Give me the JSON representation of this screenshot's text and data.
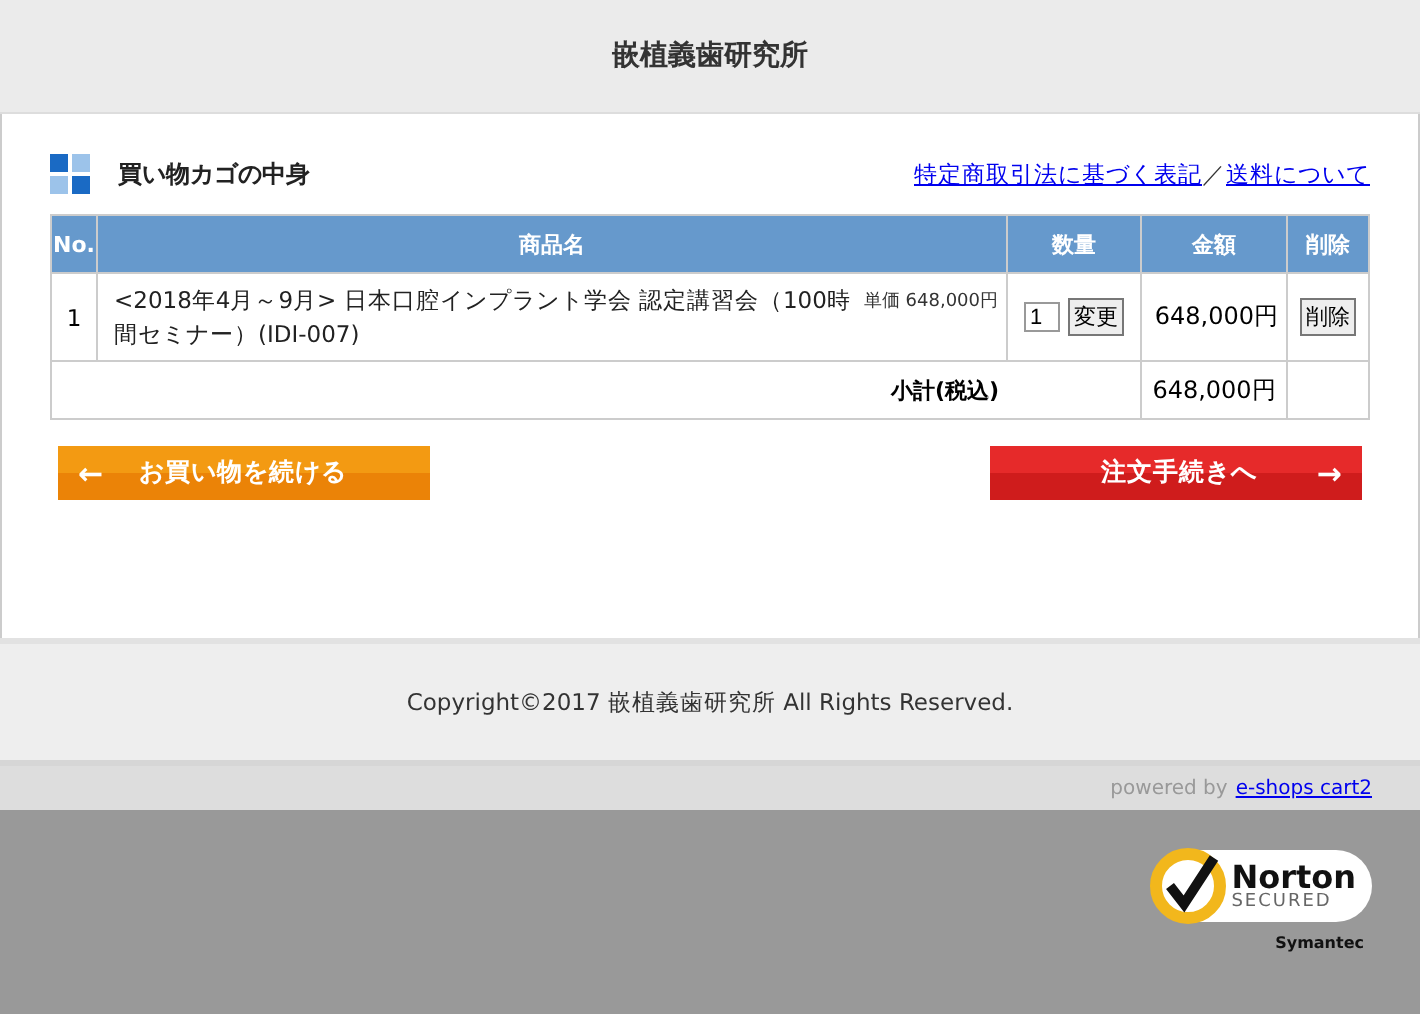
{
  "header": {
    "title": "嵌植義歯研究所"
  },
  "cart": {
    "heading": "買い物カゴの中身",
    "links": [
      "特定商取引法に基づく表記",
      "送料について"
    ],
    "separator": "／",
    "columns": [
      "No.",
      "商品名",
      "数量",
      "金額",
      "削除"
    ],
    "rows": [
      {
        "no": "1",
        "name": "<2018年4月～9月> 日本口腔インプラント学会 認定講習会（100時間セミナー）(IDI-007)",
        "unit_price": "単価 648,000円",
        "quantity": "1",
        "update_label": "変更",
        "amount": "648,000円",
        "delete_label": "削除"
      }
    ],
    "subtotal_label": "小計(税込)",
    "subtotal": "648,000円"
  },
  "buttons": [
    {
      "kind": "back",
      "label": "お買い物を続ける",
      "arrow": "←"
    },
    {
      "kind": "next",
      "label": "注文手続きへ",
      "arrow": "→"
    }
  ],
  "footer": {
    "copyright": "Copyright©2017 嵌植義歯研究所 All Rights Reserved.",
    "powered_by": "powered by",
    "powered_link": "e-shops cart2"
  },
  "badge": {
    "brand": "Norton",
    "status": "SECURED",
    "maker": "Symantec"
  }
}
